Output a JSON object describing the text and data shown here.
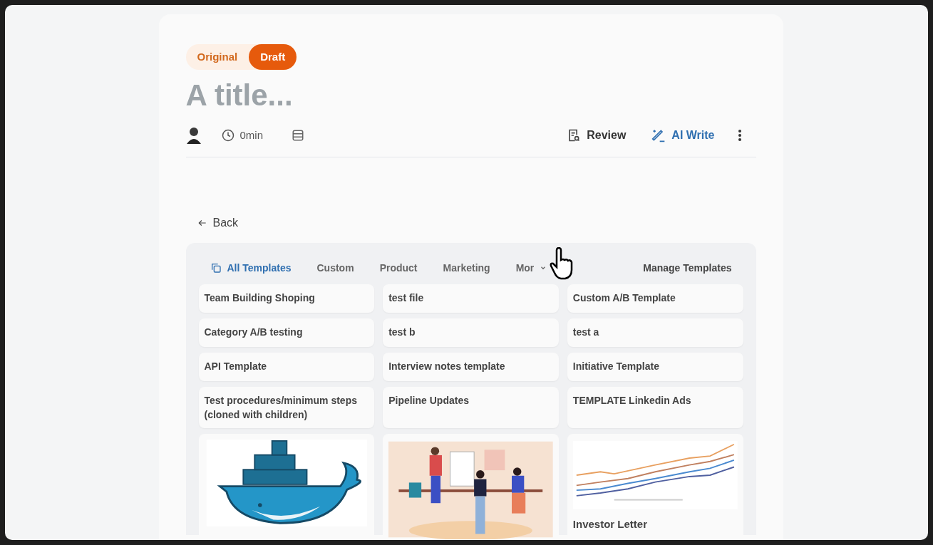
{
  "version_toggle": [
    {
      "label": "Original",
      "selected": false
    },
    {
      "label": "Draft",
      "selected": true
    }
  ],
  "title": {
    "placeholder": "A title..."
  },
  "meta": {
    "read_time": "0min"
  },
  "actions": [
    {
      "label": "Review",
      "kind": "review"
    },
    {
      "label": "AI Write",
      "kind": "ai"
    }
  ],
  "back": "Back",
  "tabs": [
    {
      "label": "All Templates",
      "selected": true
    },
    {
      "label": "Custom",
      "selected": false
    },
    {
      "label": "Product",
      "selected": false
    },
    {
      "label": "Marketing",
      "selected": false
    },
    {
      "label": "Mor",
      "selected": false
    }
  ],
  "manage": "Manage Templates",
  "templates": [
    {
      "title": "Team Building Shoping"
    },
    {
      "title": "test file"
    },
    {
      "title": "Custom A/B Template"
    },
    {
      "title": "Category A/B testing"
    },
    {
      "title": "test b"
    },
    {
      "title": "test a"
    },
    {
      "title": "API Template"
    },
    {
      "title": "Interview notes template"
    },
    {
      "title": "Initiative Template"
    },
    {
      "title": "Test procedures/minimum steps (cloned with children)"
    },
    {
      "title": "Pipeline Updates"
    },
    {
      "title": "TEMPLATE Linkedin Ads"
    }
  ],
  "preview_cards": [
    {
      "kind": "whale"
    },
    {
      "kind": "team"
    },
    {
      "kind": "chart",
      "title": "Investor Letter"
    }
  ]
}
